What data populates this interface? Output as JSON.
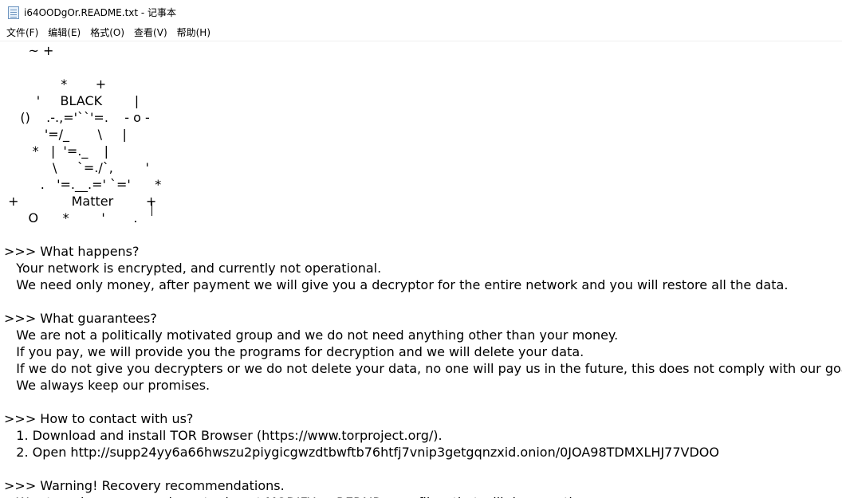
{
  "window": {
    "title": "i64OODgOr.README.txt - 记事本"
  },
  "menu": [
    "文件(F)",
    "编辑(E)",
    "格式(O)",
    "查看(V)",
    "帮助(H)"
  ],
  "document": {
    "lines": [
      "      ~ +",
      "",
      "              *       +",
      "        '     BLACK        |",
      "    ()    .-.,='``'=.    - o -",
      "          '=/_       \\     |",
      "       *   |  '=._    |",
      "            \\     `=./`,        '",
      "         .   '=.__.=' `='      *",
      " +             Matter        +",
      "      O      *        '       .",
      "",
      ">>> What happens?",
      "   Your network is encrypted, and currently not operational.",
      "   We need only money, after payment we will give you a decryptor for the entire network and you will restore all the data.",
      "",
      ">>> What guarantees?",
      "   We are not a politically motivated group and we do not need anything other than your money.",
      "   If you pay, we will provide you the programs for decryption and we will delete your data.",
      "   If we do not give you decrypters or we do not delete your data, no one will pay us in the future, this does not comply with our goals.",
      "   We always keep our promises.",
      "",
      ">>> How to contact with us?",
      "   1. Download and install TOR Browser (https://www.torproject.org/).",
      "   2. Open http://supp24yy6a66hwszu2piygicgwzdtbwftb76htfj7vnip3getgqnzxid.onion/0JOA98TDMXLHJ77VDOO",
      "",
      ">>> Warning! Recovery recommendations.",
      "   We strongly recommend you to do not MODIFY or REPAIR your files, that will damage them."
    ]
  }
}
